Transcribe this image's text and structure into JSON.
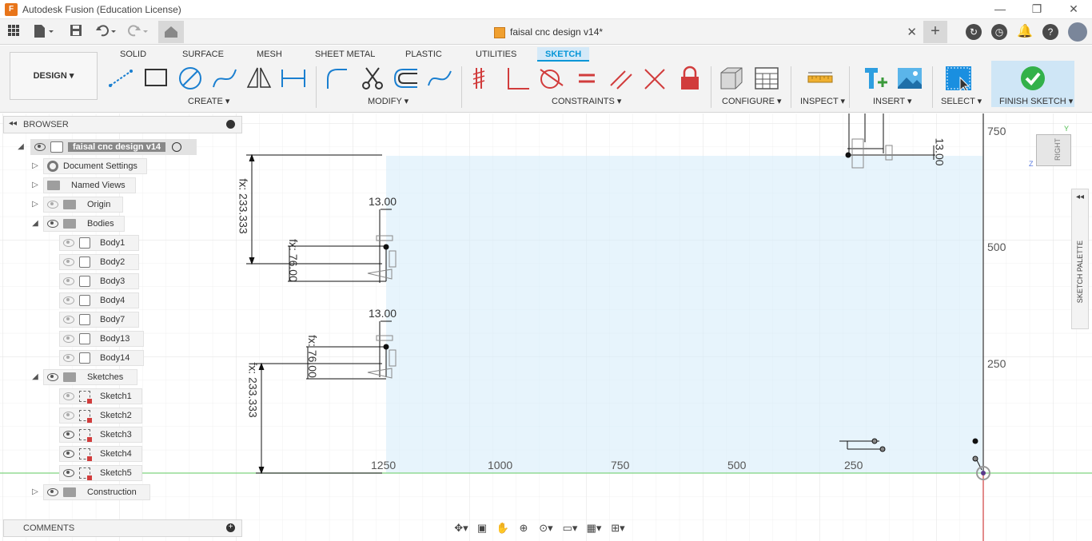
{
  "titlebar": {
    "app_title": "Autodesk Fusion (Education License)",
    "logo_letter": "F",
    "controls": {
      "minimize": "—",
      "restore": "❐",
      "close": "✕"
    }
  },
  "qabar": {
    "doc_title": "faisal cnc design v14*",
    "close": "✕",
    "new_tab": "+",
    "icons": [
      "grid-icon",
      "file-icon",
      "save-icon",
      "undo-icon",
      "redo-icon",
      "home-icon",
      "refresh-icon",
      "clock-icon",
      "bell-icon",
      "help-icon",
      "avatar"
    ]
  },
  "ribbon": {
    "workspace": "DESIGN ▾",
    "tabs": [
      {
        "label": "SOLID"
      },
      {
        "label": "SURFACE"
      },
      {
        "label": "MESH"
      },
      {
        "label": "SHEET METAL"
      },
      {
        "label": "PLASTIC"
      },
      {
        "label": "UTILITIES"
      },
      {
        "label": "SKETCH"
      }
    ],
    "active_tab": "SKETCH",
    "groups": {
      "create": "CREATE ▾",
      "modify": "MODIFY ▾",
      "constraints": "CONSTRAINTS ▾",
      "configure": "CONFIGURE ▾",
      "inspect": "INSPECT ▾",
      "insert": "INSERT ▾",
      "select": "SELECT ▾",
      "finish": "FINISH SKETCH ▾"
    },
    "accent": "#0696d7"
  },
  "browser": {
    "title": "BROWSER",
    "root": "faisal cnc design v14",
    "items": {
      "doc_settings": "Document Settings",
      "named_views": "Named Views",
      "origin": "Origin",
      "bodies": "Bodies",
      "body1": "Body1",
      "body2": "Body2",
      "body3": "Body3",
      "body4": "Body4",
      "body7": "Body7",
      "body13": "Body13",
      "body14": "Body14",
      "sketches": "Sketches",
      "sketch1": "Sketch1",
      "sketch2": "Sketch2",
      "sketch3": "Sketch3",
      "sketch4": "Sketch4",
      "sketch5": "Sketch5",
      "construction": "Construction"
    }
  },
  "comments": {
    "title": "COMMENTS"
  },
  "canvas": {
    "x_scale": [
      "1250",
      "1000",
      "750",
      "500",
      "250"
    ],
    "y_scale": [
      "750",
      "500",
      "250"
    ],
    "dimensions": {
      "d1": "fx: 233.333",
      "d2": "13.00",
      "d3": "fx: 76.00",
      "d4": "13.00",
      "d5": "fx: 76.00",
      "d6": "fx: 233.333",
      "d7": "13.00"
    }
  },
  "viewcube": {
    "face": "RIGHT",
    "y_axis": "Y",
    "z_axis": "Z"
  },
  "palette": {
    "label": "SKETCH PALETTE"
  }
}
